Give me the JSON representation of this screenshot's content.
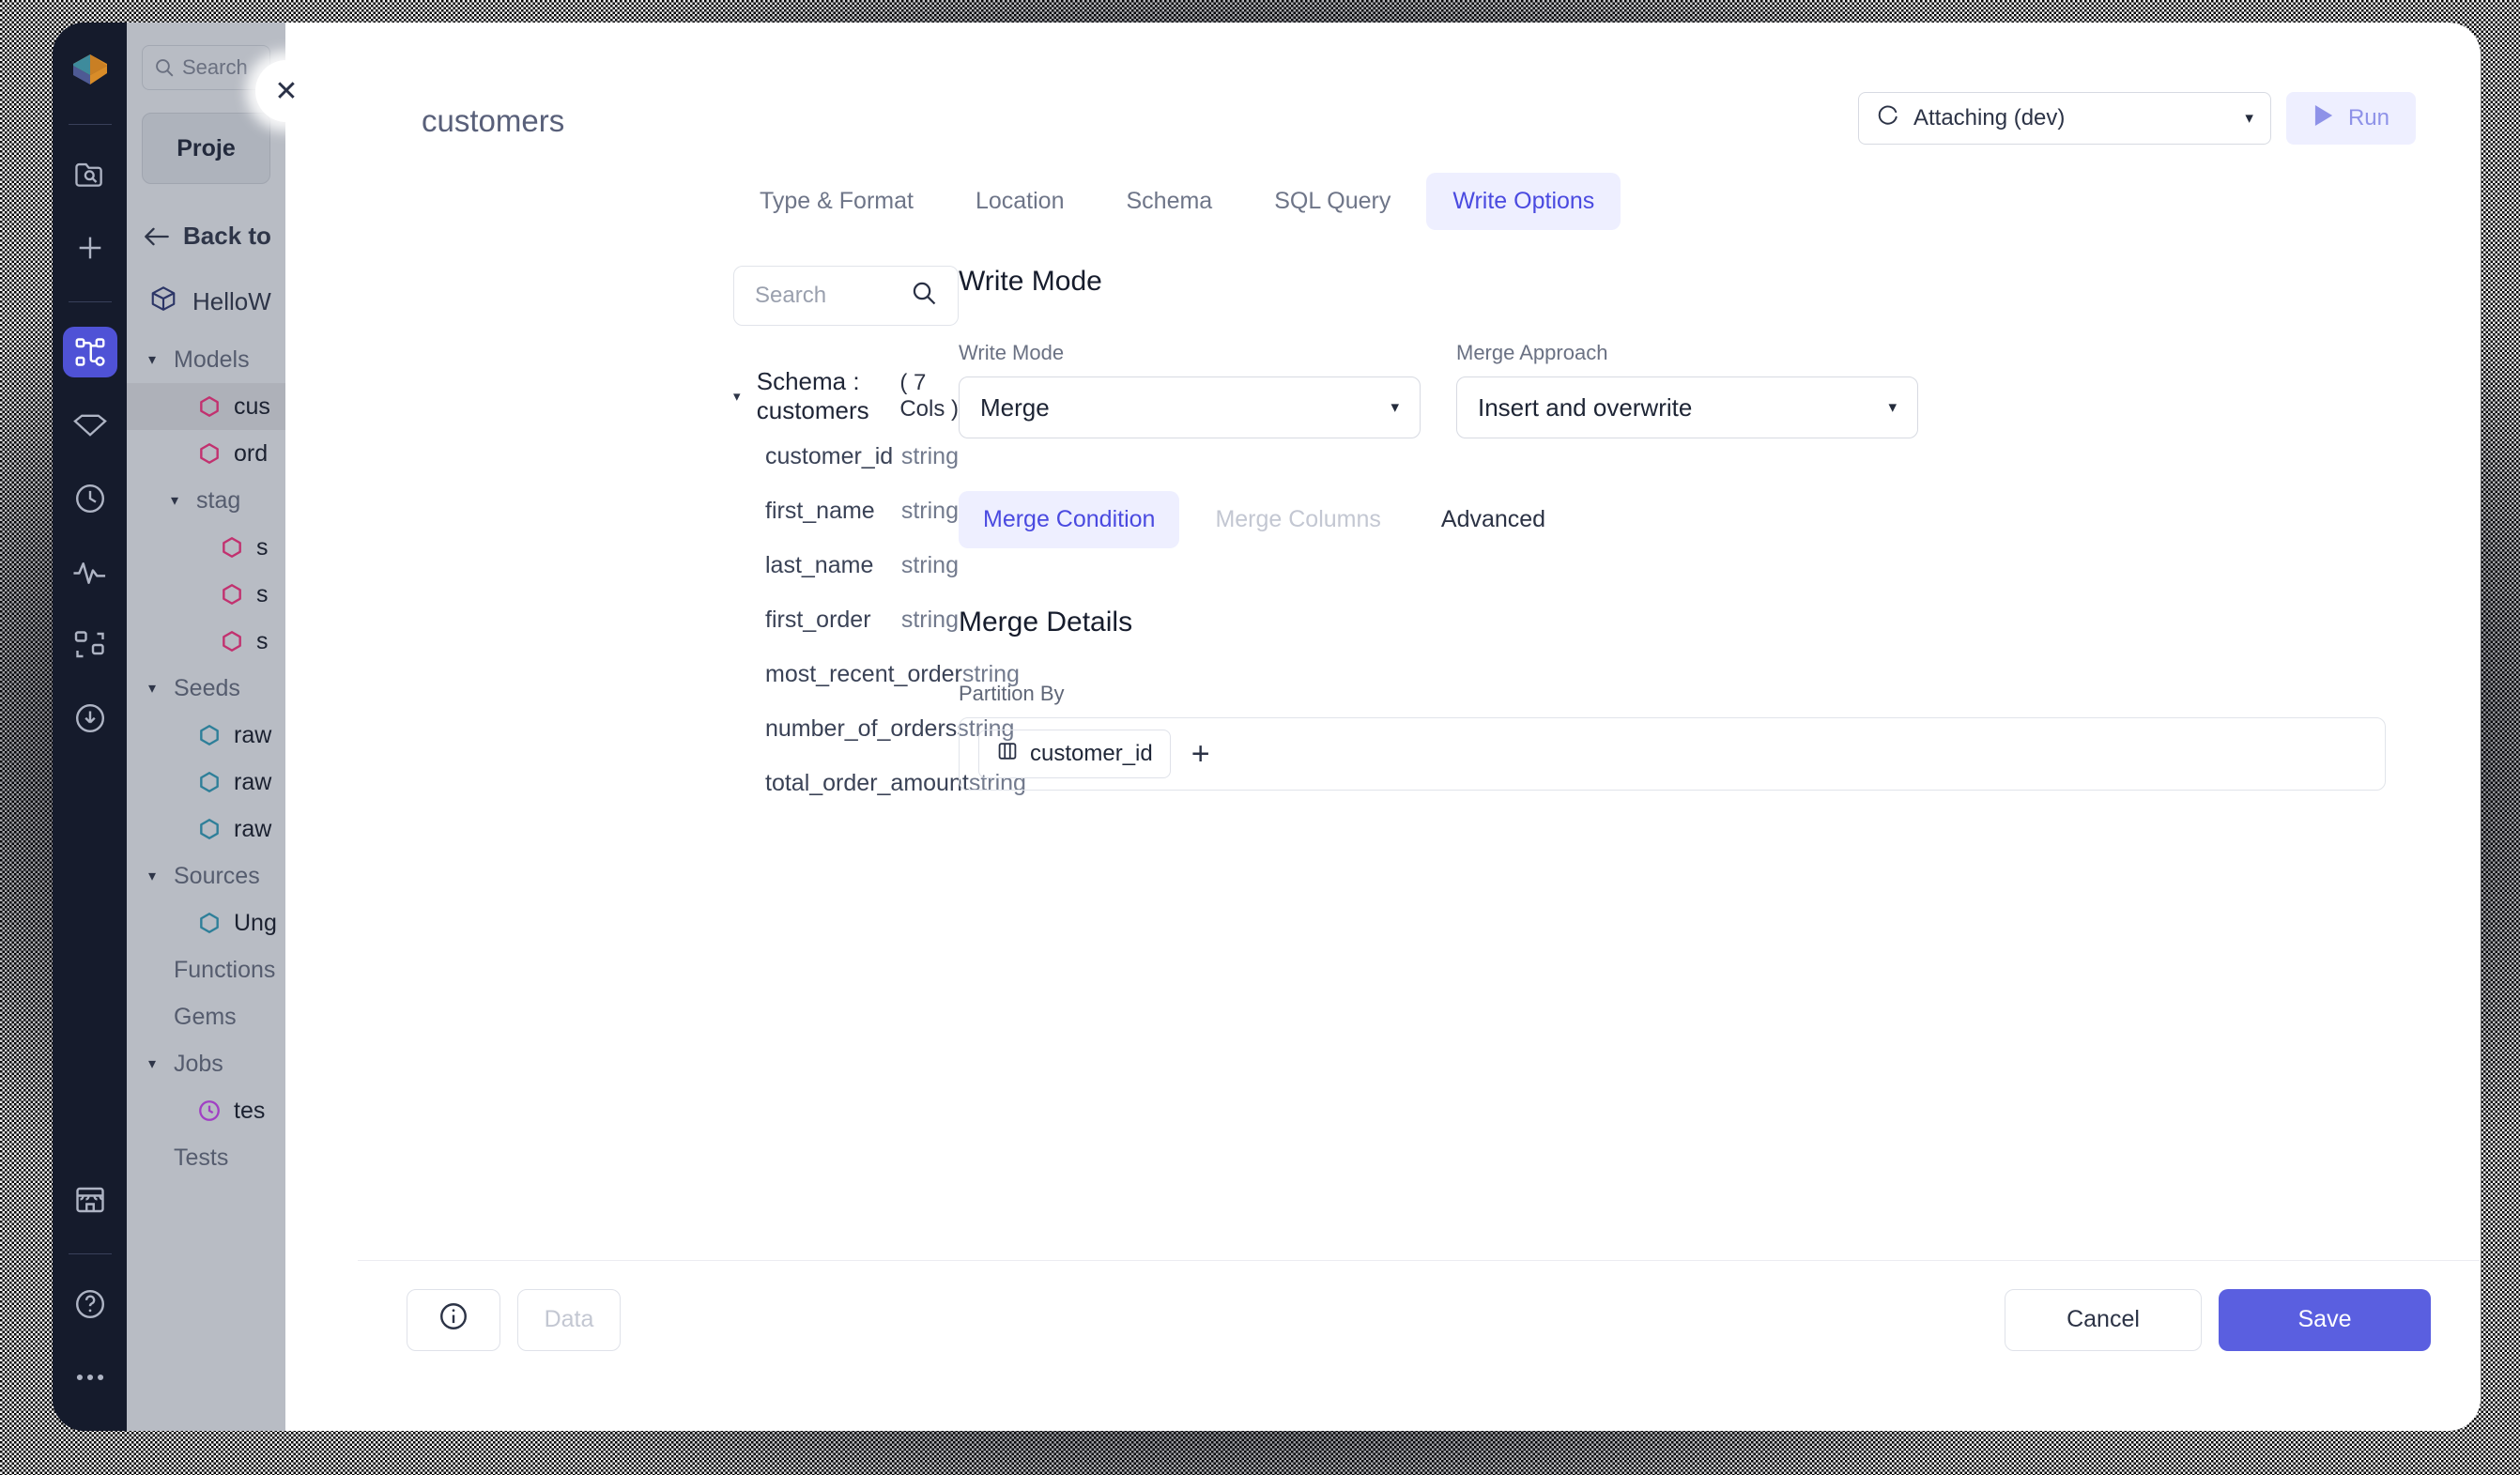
{
  "rail": {
    "icons": [
      {
        "name": "logo-icon",
        "label": "Prophecy logo"
      },
      {
        "name": "folder-search-icon",
        "label": "Browse"
      },
      {
        "name": "plus-icon",
        "label": "Create"
      },
      {
        "name": "pipeline-icon",
        "label": "Pipelines"
      },
      {
        "name": "gem-icon",
        "label": "Gems"
      },
      {
        "name": "clock-icon",
        "label": "History"
      },
      {
        "name": "activity-icon",
        "label": "Monitoring"
      },
      {
        "name": "cluster-icon",
        "label": "Clusters"
      },
      {
        "name": "download-icon",
        "label": "Deployments"
      },
      {
        "name": "store-icon",
        "label": "Marketplace"
      },
      {
        "name": "help-icon",
        "label": "Help"
      },
      {
        "name": "more-icon",
        "label": "More"
      }
    ]
  },
  "sidebar": {
    "search_placeholder": "Search",
    "project_button": "Proje",
    "back_label": "Back to",
    "project_name": "HelloW",
    "tree": [
      {
        "label": "Models",
        "type": "group",
        "caret": "▾",
        "indent": 0
      },
      {
        "label": "cus",
        "type": "model",
        "indent": 1,
        "selected": true
      },
      {
        "label": "ord",
        "type": "model",
        "indent": 1,
        "selected": false
      },
      {
        "label": "stag",
        "type": "group",
        "caret": "▾",
        "indent": 1
      },
      {
        "label": "s",
        "type": "model",
        "indent": 2,
        "selected": false
      },
      {
        "label": "s",
        "type": "model",
        "indent": 2,
        "selected": false
      },
      {
        "label": "s",
        "type": "model",
        "indent": 2,
        "selected": false
      },
      {
        "label": "Seeds",
        "type": "group",
        "caret": "▾",
        "indent": 0
      },
      {
        "label": "raw",
        "type": "seed",
        "indent": 1,
        "selected": false
      },
      {
        "label": "raw",
        "type": "seed",
        "indent": 1,
        "selected": false
      },
      {
        "label": "raw",
        "type": "seed",
        "indent": 1,
        "selected": false
      },
      {
        "label": "Sources",
        "type": "group",
        "caret": "▾",
        "indent": 0
      },
      {
        "label": "Ung",
        "type": "seed",
        "indent": 1,
        "selected": false
      },
      {
        "label": "Functions",
        "type": "plain",
        "indent": 0
      },
      {
        "label": "Gems",
        "type": "plain",
        "indent": 0
      },
      {
        "label": "Jobs",
        "type": "group",
        "caret": "▾",
        "indent": 0
      },
      {
        "label": "tes",
        "type": "job",
        "indent": 1,
        "selected": false
      },
      {
        "label": "Tests",
        "type": "plain",
        "indent": 0
      }
    ]
  },
  "modal": {
    "title": "customers",
    "close_label": "✕",
    "environment": {
      "status_label": "Attaching (dev)",
      "caret": "▾"
    },
    "run_button": "Run",
    "tabs": [
      {
        "label": "Type & Format",
        "active": false
      },
      {
        "label": "Location",
        "active": false
      },
      {
        "label": "Schema",
        "active": false
      },
      {
        "label": "SQL Query",
        "active": false
      },
      {
        "label": "Write Options",
        "active": true
      }
    ],
    "schema_panel": {
      "search_placeholder": "Search",
      "header_label": "Schema : customers",
      "header_caret": "▾",
      "column_count": "( 7 Cols )",
      "columns": [
        {
          "name": "customer_id",
          "type": "string"
        },
        {
          "name": "first_name",
          "type": "string"
        },
        {
          "name": "last_name",
          "type": "string"
        },
        {
          "name": "first_order",
          "type": "string"
        },
        {
          "name": "most_recent_order",
          "type": "string"
        },
        {
          "name": "number_of_orders",
          "type": "string"
        },
        {
          "name": "total_order_amount",
          "type": "string"
        }
      ]
    },
    "write_options": {
      "section_title": "Write Mode",
      "write_mode_label": "Write Mode",
      "write_mode_value": "Merge",
      "merge_approach_label": "Merge Approach",
      "merge_approach_value": "Insert and overwrite",
      "caret": "▾",
      "sub_tabs": [
        {
          "label": "Merge Condition",
          "state": "active"
        },
        {
          "label": "Merge Columns",
          "state": "disabled"
        },
        {
          "label": "Advanced",
          "state": "normal"
        }
      ],
      "merge_details_title": "Merge Details",
      "partition_by_label": "Partition By",
      "partition_chips": [
        "customer_id"
      ],
      "add_partition_label": "+"
    },
    "footer": {
      "info_label": "i",
      "data_label": "Data",
      "cancel_label": "Cancel",
      "save_label": "Save"
    }
  },
  "colors": {
    "accent": "#5a5fe0",
    "accent_soft": "#eeefff",
    "rail_bg": "#151b2c",
    "sidebar_bg": "#b8bcc4",
    "model_hex": "#c2316f",
    "seed_hex": "#2e7f99",
    "job_hex": "#a13fc4"
  }
}
